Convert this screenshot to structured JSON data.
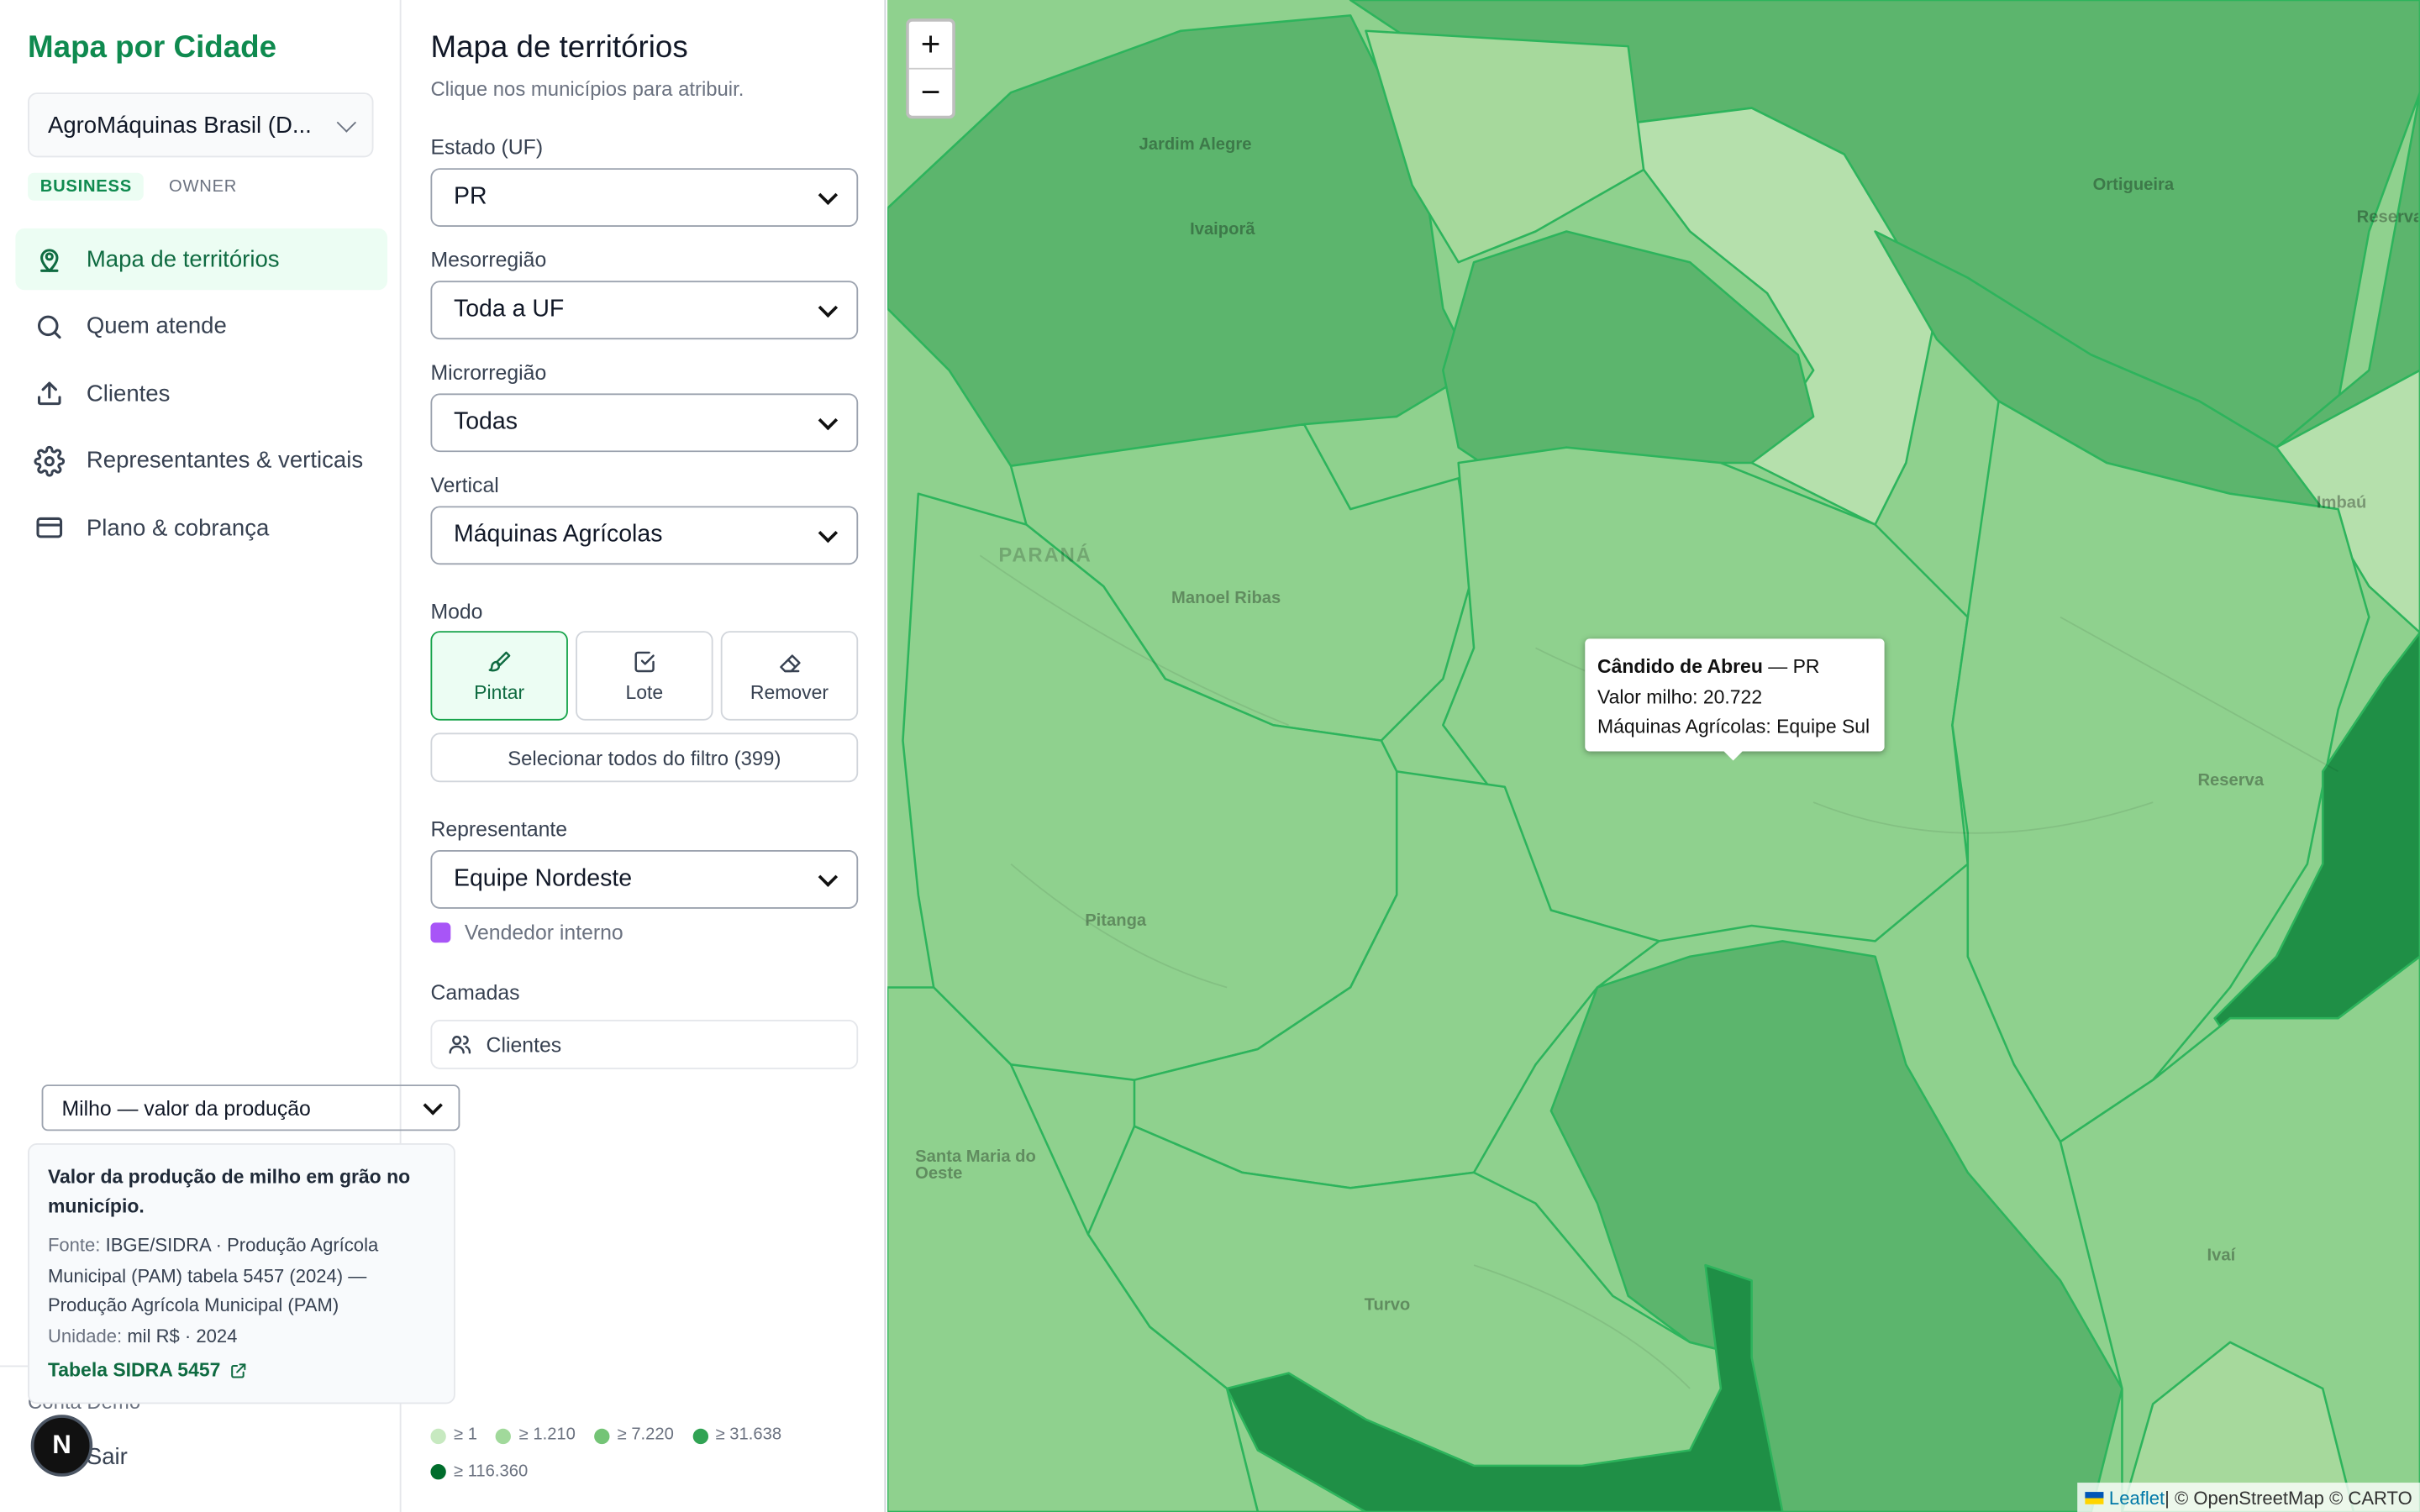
{
  "app": {
    "brand": "Mapa por Cidade"
  },
  "org": {
    "name": "AgroMáquinas Brasil (D..."
  },
  "roles": [
    "BUSINESS",
    "OWNER"
  ],
  "nav": [
    {
      "label": "Mapa de territórios",
      "icon": "map-pin-icon",
      "active": true
    },
    {
      "label": "Quem atende",
      "icon": "search-icon"
    },
    {
      "label": "Clientes",
      "icon": "upload-icon"
    },
    {
      "label": "Representantes & verticais",
      "icon": "gear-icon"
    },
    {
      "label": "Plano & cobrança",
      "icon": "credit-card-icon"
    }
  ],
  "footer": {
    "account": "Conta Demo",
    "logout": "Sair",
    "badge": "N"
  },
  "panel": {
    "title": "Mapa de territórios",
    "subtitle": "Clique nos municípios para atribuir.",
    "uf": {
      "label": "Estado (UF)",
      "value": "PR"
    },
    "meso": {
      "label": "Mesorregião",
      "value": "Toda a UF"
    },
    "micro": {
      "label": "Microrregião",
      "value": "Todas"
    },
    "vertical": {
      "label": "Vertical",
      "value": "Máquinas Agrícolas"
    },
    "modo": {
      "label": "Modo",
      "pintar": "Pintar",
      "lote": "Lote",
      "remover": "Remover"
    },
    "select_all": "Selecionar todos do filtro (399)",
    "rep": {
      "label": "Representante",
      "value": "Equipe Nordeste",
      "interno": "Vendedor interno",
      "interno_color": "#a855f7"
    },
    "camadas": {
      "label": "Camadas",
      "clientes": "Clientes",
      "layer": "Milho — valor da produção"
    },
    "info": {
      "title": "Valor da produção de milho em grão no município.",
      "fonte_k": "Fonte:",
      "fonte_v": "IBGE/SIDRA · Produção Agrícola Municipal (PAM) tabela 5457 (2024) — Produção Agrícola Municipal (PAM)",
      "unidade_k": "Unidade:",
      "unidade_v": "mil R$ · 2024",
      "link": "Tabela SIDRA 5457"
    },
    "legend": [
      {
        "label": "≥ 1",
        "color": "#c7e9c0"
      },
      {
        "label": "≥ 1.210",
        "color": "#a1d99b"
      },
      {
        "label": "≥ 7.220",
        "color": "#74c476"
      },
      {
        "label": "≥ 31.638",
        "color": "#31a354"
      },
      {
        "label": "≥ 116.360",
        "color": "#006d2c"
      }
    ]
  },
  "map": {
    "zoom_in": "+",
    "zoom_out": "−",
    "tooltip": {
      "city": "Cândido de Abreu",
      "uf": " — PR",
      "line2": "Valor milho: 20.722",
      "line3": "Máquinas Agrícolas: Equipe Sul"
    },
    "attribution": {
      "leaflet": "Leaflet",
      "rest": " | © OpenStreetMap © CARTO"
    },
    "places": [
      "Jardim Alegre",
      "Ivaiporã",
      "Ortigueira",
      "Manoel Ribas",
      "PARANÁ",
      "Reserva",
      "Pitanga",
      "Santa Maria do Oeste",
      "Turvo",
      "Ivaí",
      "Imbaú",
      "Reserva do Iguaçu"
    ]
  }
}
